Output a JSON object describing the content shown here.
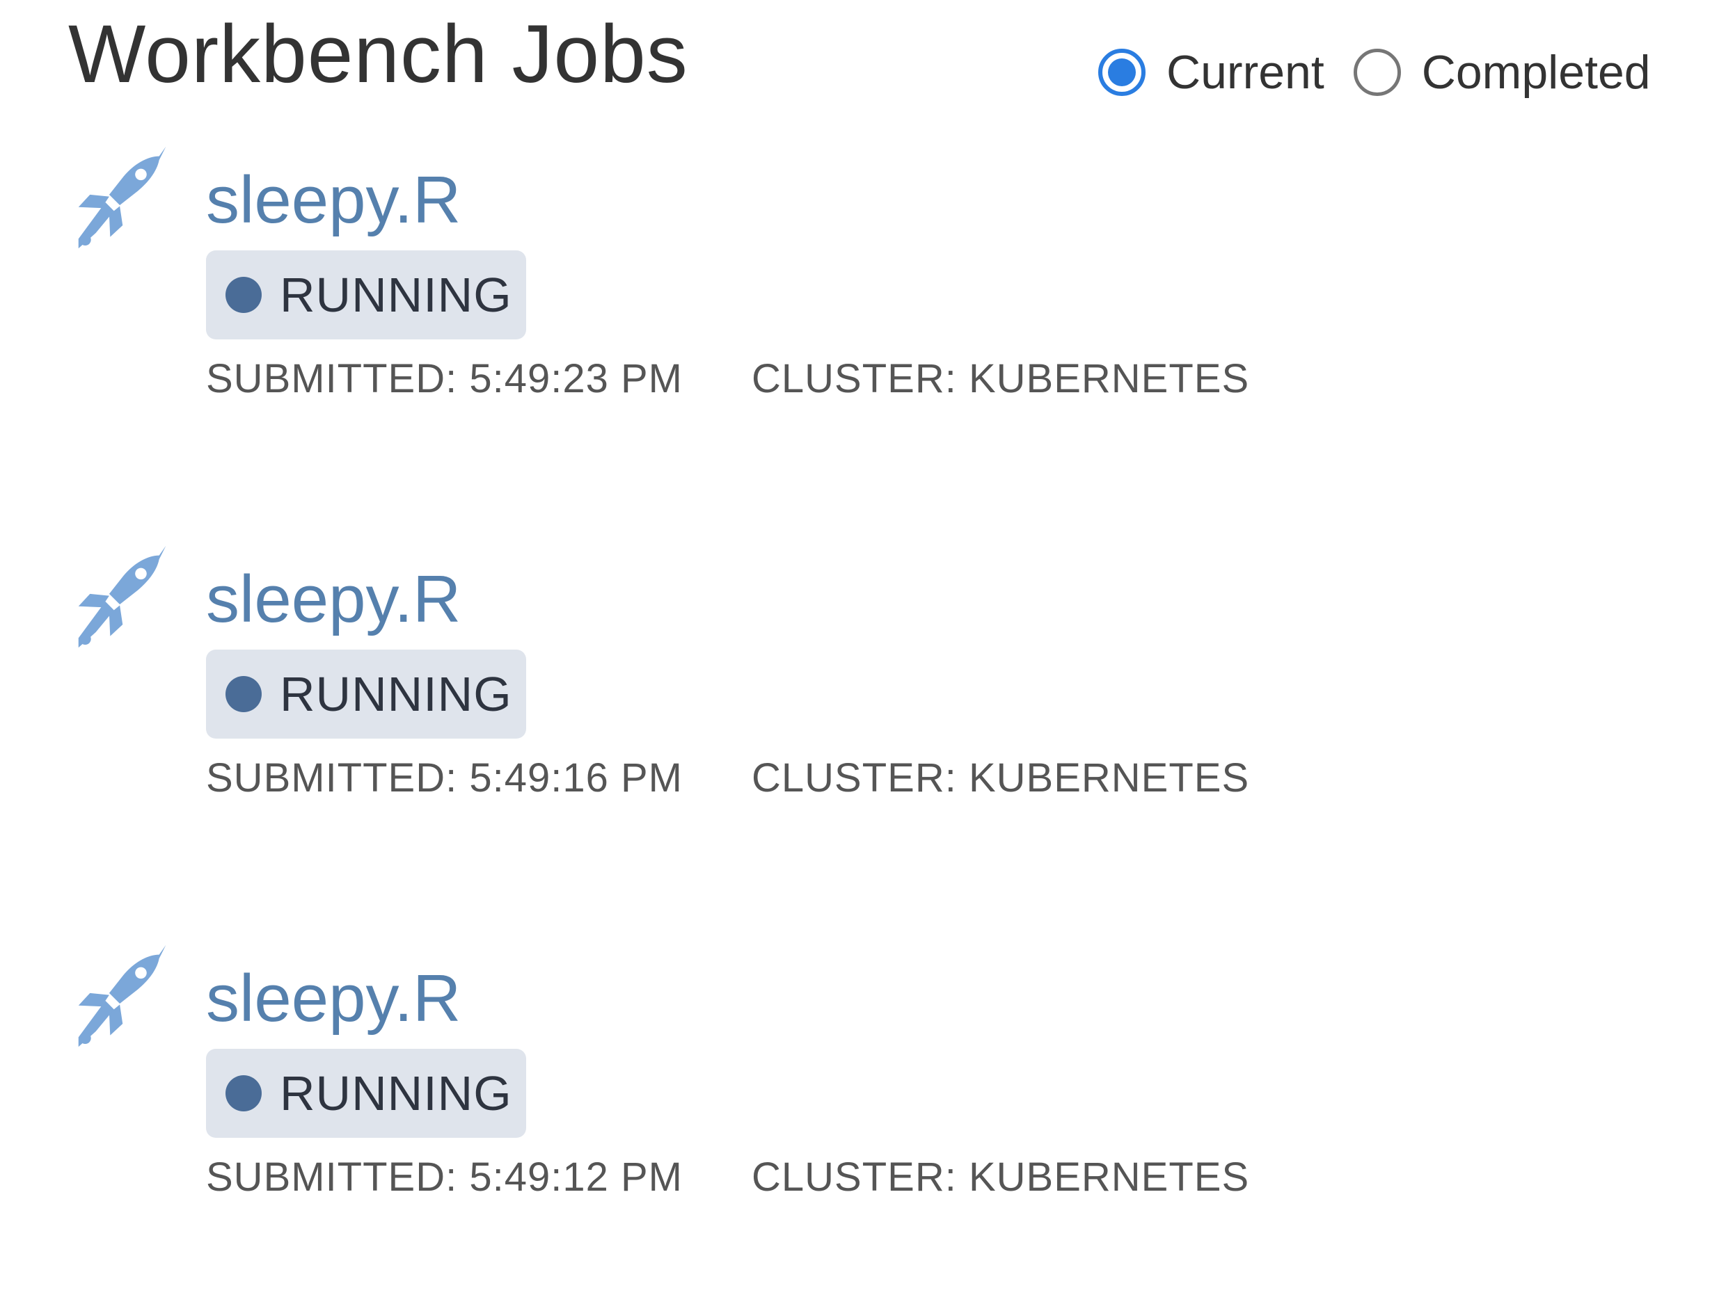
{
  "header": {
    "title": "Workbench Jobs"
  },
  "filter": {
    "options": [
      {
        "label": "Current",
        "selected": true
      },
      {
        "label": "Completed",
        "selected": false
      }
    ]
  },
  "jobs": [
    {
      "icon": "rocket-icon",
      "name": "sleepy.R",
      "status": "RUNNING",
      "submitted": "SUBMITTED: 5:49:23 PM",
      "cluster": "CLUSTER: KUBERNETES"
    },
    {
      "icon": "rocket-icon",
      "name": "sleepy.R",
      "status": "RUNNING",
      "submitted": "SUBMITTED: 5:49:16 PM",
      "cluster": "CLUSTER: KUBERNETES"
    },
    {
      "icon": "rocket-icon",
      "name": "sleepy.R",
      "status": "RUNNING",
      "submitted": "SUBMITTED: 5:49:12 PM",
      "cluster": "CLUSTER: KUBERNETES"
    }
  ],
  "colors": {
    "job_name": "#5580ad",
    "icon": "#7ba7d9",
    "status_badge_bg": "#dfe4ec",
    "status_dot": "#4a6c97",
    "radio_selected": "#2a7de1"
  }
}
